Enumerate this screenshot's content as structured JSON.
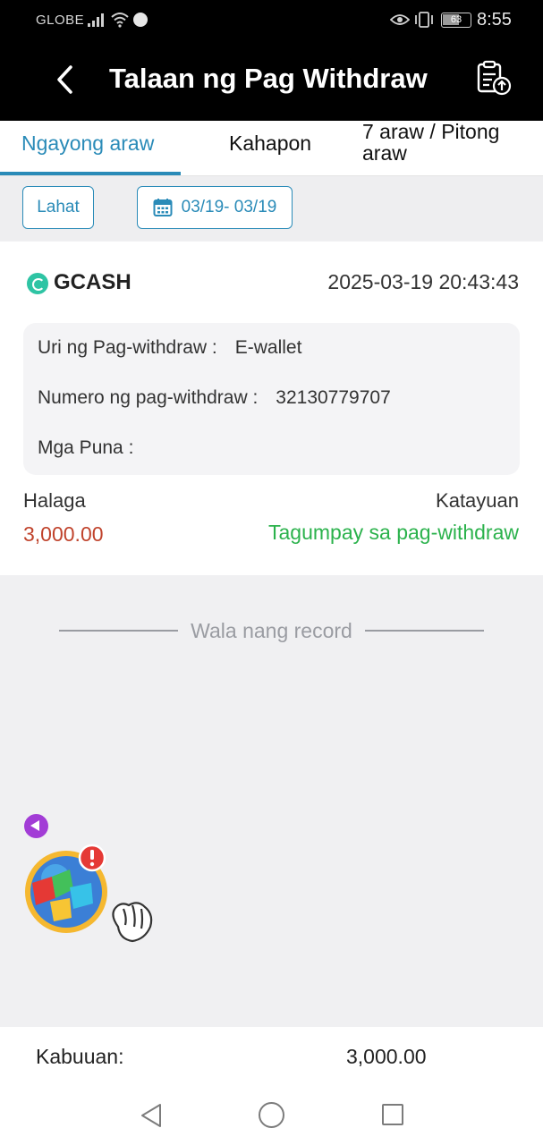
{
  "status_bar": {
    "carrier": "GLOBE",
    "battery": "63",
    "time": "8:55",
    "icons": [
      "signal-icon",
      "wifi-icon",
      "messenger-icon",
      "eye-comfort-icon",
      "vibrate-icon",
      "battery-icon"
    ]
  },
  "header": {
    "title": "Talaan ng Pag Withdraw",
    "back_icon": "chevron-left-icon",
    "action_icon": "clipboard-upload-icon"
  },
  "tabs": [
    {
      "label": "Ngayong araw",
      "active": true
    },
    {
      "label": "Kahapon",
      "active": false
    },
    {
      "label": "7 araw / Pitong araw",
      "active": false
    }
  ],
  "filters": {
    "all_label": "Lahat",
    "date_range": "03/19- 03/19",
    "date_icon": "calendar-icon"
  },
  "record": {
    "provider": "GCASH",
    "datetime": "2025-03-19 20:43:43",
    "type_label": "Uri ng Pag-withdraw :",
    "type_value": "E-wallet",
    "number_label": "Numero ng pag-withdraw :",
    "number_value": "32130779707",
    "remarks_label": "Mga Puna :",
    "remarks_value": "",
    "amount_label": "Halaga",
    "amount_value": "3,000.00",
    "status_label": "Katayuan",
    "status_value": "Tagumpay sa pag-withdraw"
  },
  "no_more_records": "Wala nang record",
  "footer": {
    "total_label": "Kabuuan:",
    "total_value": "3,000.00"
  },
  "colors": {
    "accent": "#2a8bb8",
    "amount": "#c0432c",
    "success": "#2bb24c",
    "header_bg": "#000000"
  }
}
